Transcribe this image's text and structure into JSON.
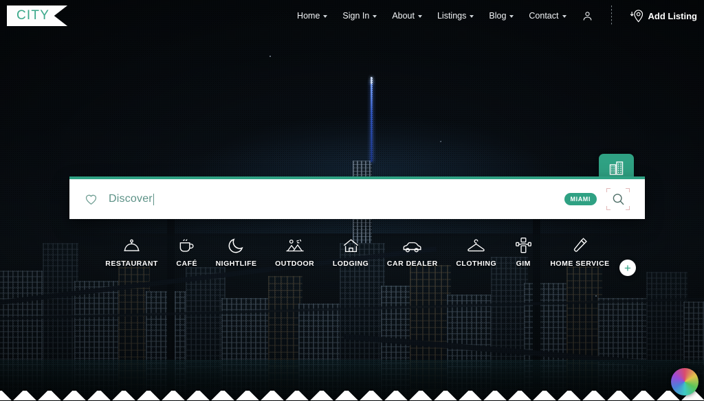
{
  "header": {
    "logo_text": "CITY",
    "nav_items": [
      {
        "label": "Home",
        "has_caret": true
      },
      {
        "label": "Sign In",
        "has_caret": true
      },
      {
        "label": "About",
        "has_caret": true
      },
      {
        "label": "Listings",
        "has_caret": true
      },
      {
        "label": "Blog",
        "has_caret": true
      },
      {
        "label": "Contact",
        "has_caret": true
      }
    ],
    "account_icon": "user-icon",
    "add_listing_icon": "map-pin-add-icon",
    "add_listing_label": "Add Listing"
  },
  "search": {
    "tab_icon": "city-buildings-icon",
    "left_icon": "heart-icon",
    "value": "Discover",
    "placeholder": "Discover",
    "city_badge": "MIAMI",
    "search_icon": "search-icon",
    "accent_color": "#2fa183",
    "text_color": "#5d9287"
  },
  "categories": {
    "items": [
      {
        "label": "RESTAURANT",
        "icon": "food-cloche-icon"
      },
      {
        "label": "CAFÉ",
        "icon": "coffee-cup-icon"
      },
      {
        "label": "NIGHTLIFE",
        "icon": "moon-icon"
      },
      {
        "label": "OUTDOOR",
        "icon": "mountain-tree-icon"
      },
      {
        "label": "LODGING",
        "icon": "house-icon"
      },
      {
        "label": "CAR DEALER",
        "icon": "car-icon"
      },
      {
        "label": "CLOTHING",
        "icon": "hanger-icon"
      },
      {
        "label": "GIM",
        "icon": "dumbbell-icon"
      },
      {
        "label": "HOME SERVICE",
        "icon": "saw-tool-icon"
      }
    ],
    "add_more_label": "+",
    "add_more_icon": "plus-icon"
  },
  "widgets": {
    "color_wheel_icon": "color-wheel-icon"
  }
}
